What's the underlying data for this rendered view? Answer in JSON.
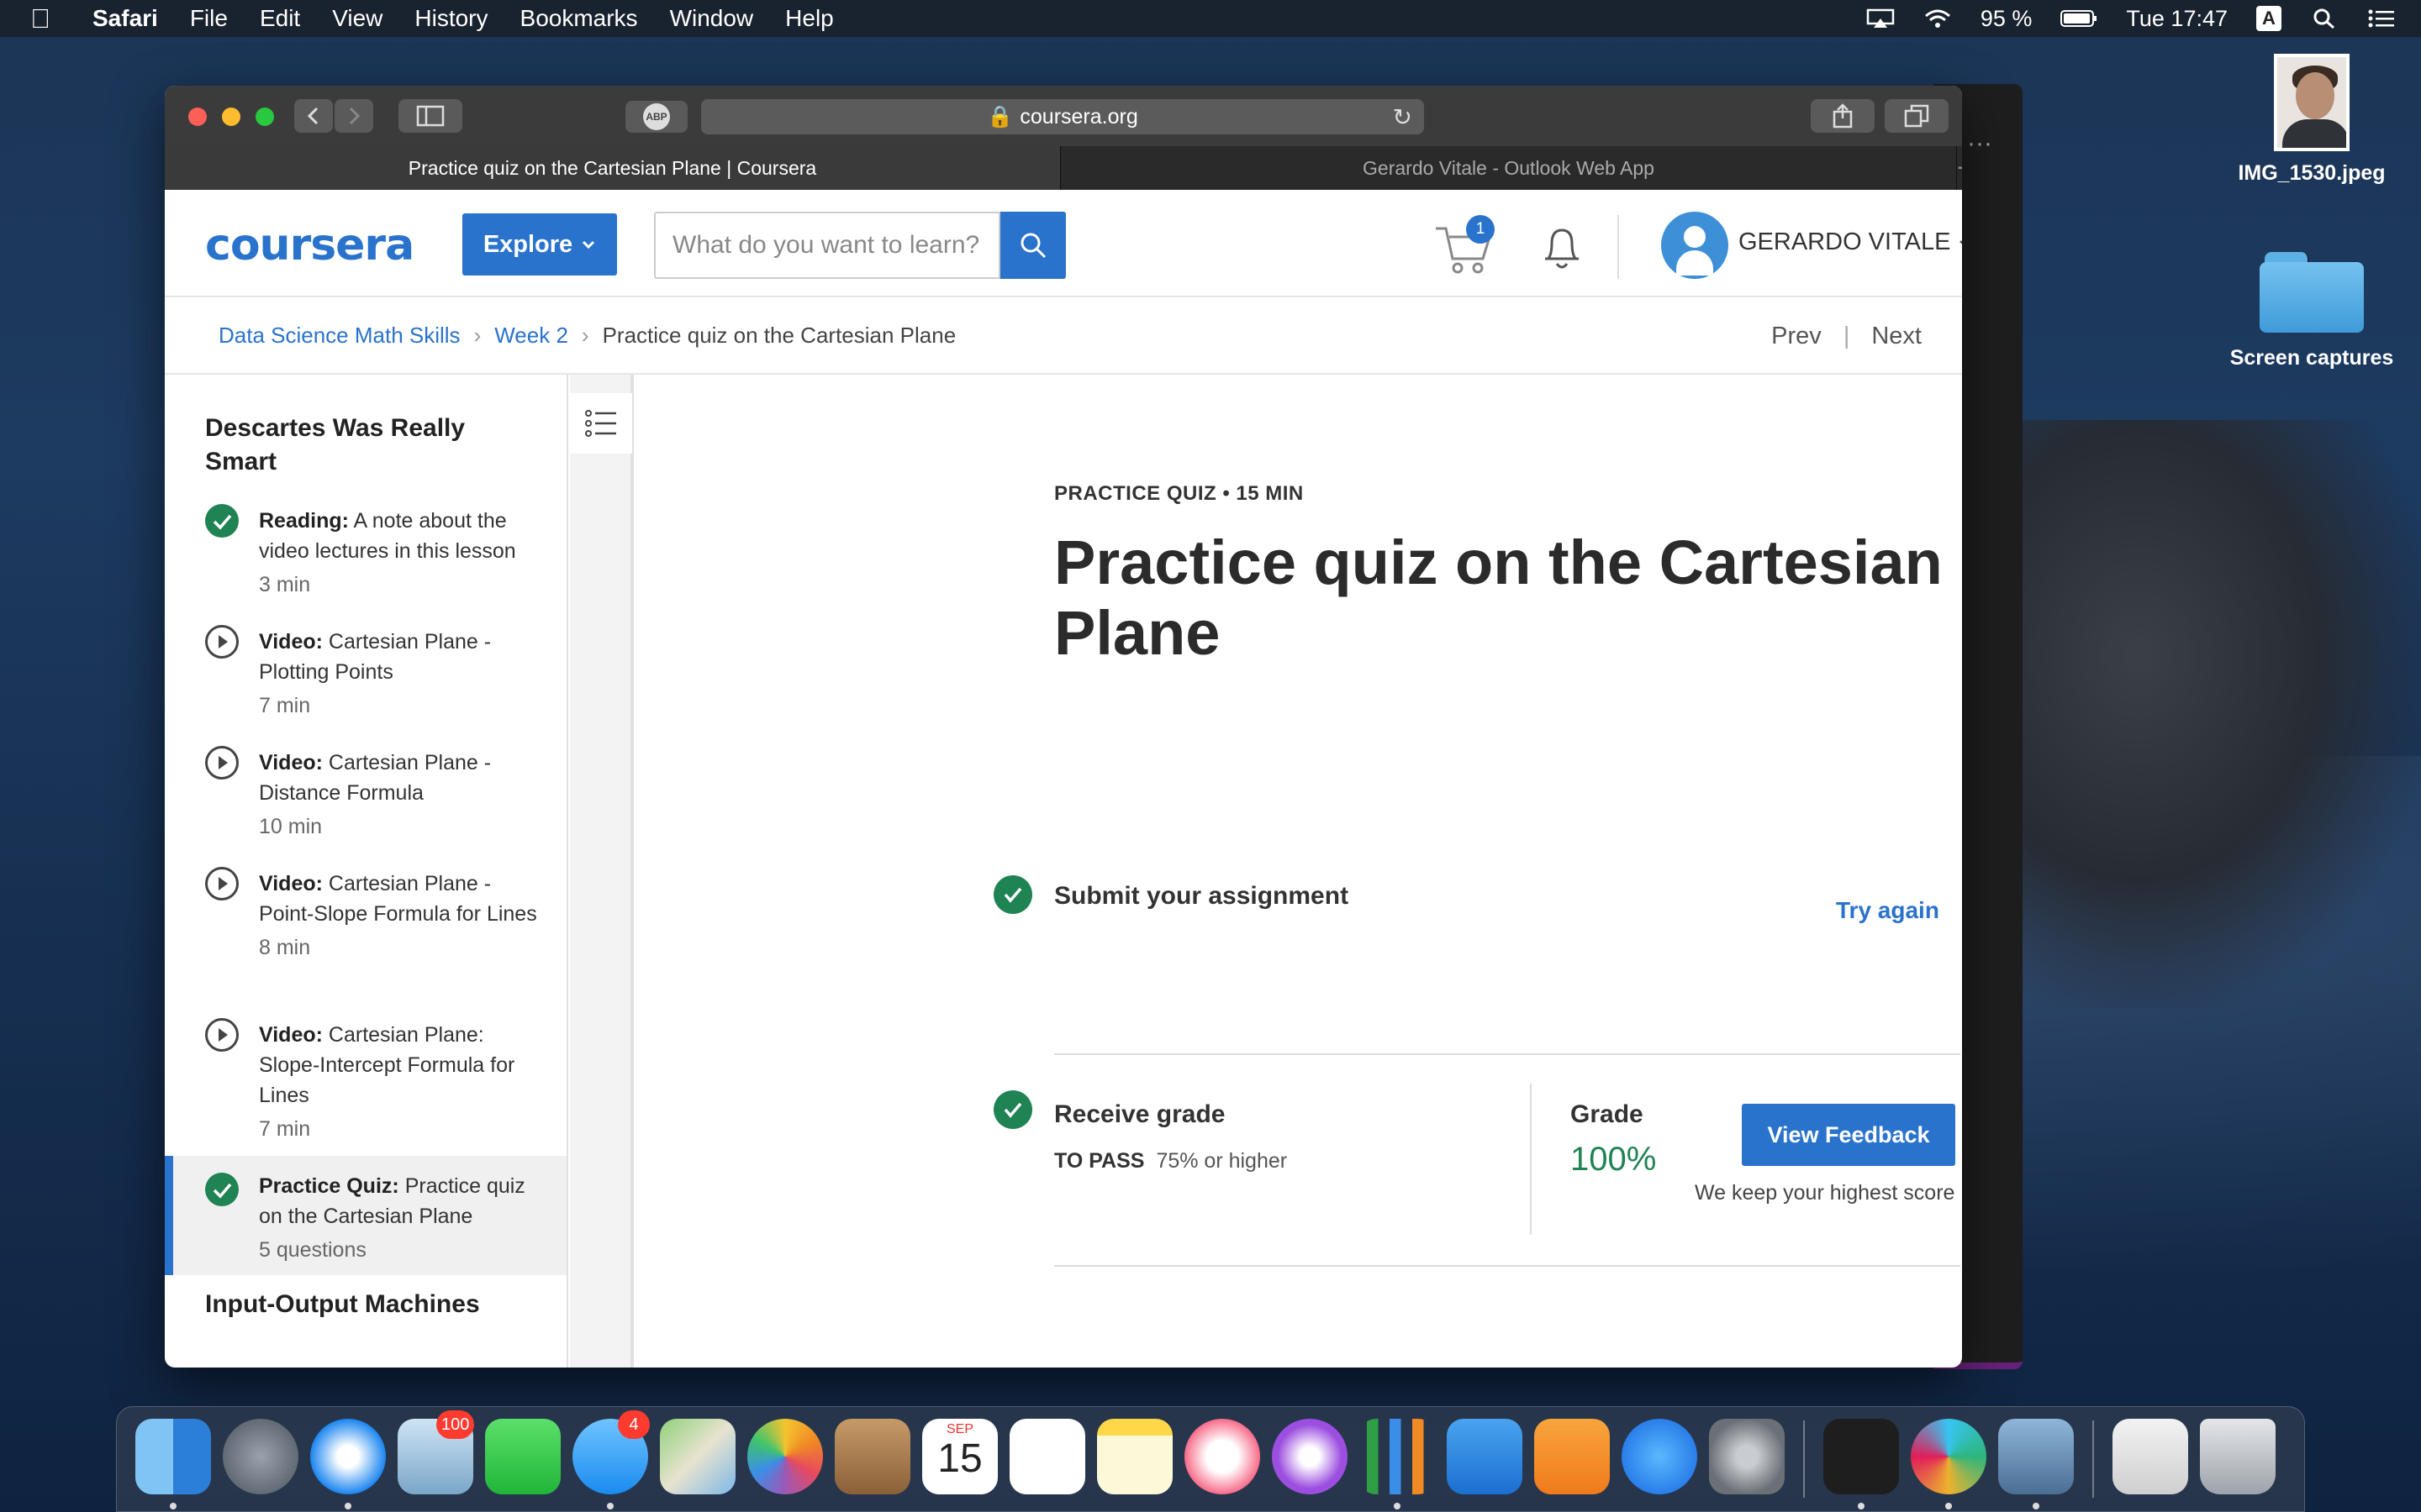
{
  "menubar": {
    "app": "Safari",
    "items": [
      "File",
      "Edit",
      "View",
      "History",
      "Bookmarks",
      "Window",
      "Help"
    ],
    "battery": "95 %",
    "clock": "Tue 17:47",
    "input_source": "A"
  },
  "desktop": {
    "photo_label": "IMG_1530.jpeg",
    "folder_label": "Screen captures"
  },
  "browser": {
    "url": "coursera.org",
    "abp": "ABP",
    "tabs": [
      {
        "title": "Practice quiz on the Cartesian Plane | Coursera"
      },
      {
        "title": "Gerardo Vitale - Outlook Web App"
      }
    ]
  },
  "header": {
    "logo": "coursera",
    "explore_label": "Explore",
    "search_placeholder": "What do you want to learn?",
    "cart_count": "1",
    "user_name": "GERARDO VITALE"
  },
  "breadcrumb": {
    "items": [
      "Data Science Math Skills",
      "Week 2"
    ],
    "current": "Practice quiz on the Cartesian Plane",
    "prev": "Prev",
    "next": "Next"
  },
  "sidebar": {
    "lesson_title": "Descartes Was Really Smart",
    "items": [
      {
        "type": "Reading:",
        "title": "A note about the video lectures in this lesson",
        "meta": "3 min",
        "status": "done"
      },
      {
        "type": "Video:",
        "title": "Cartesian Plane - Plotting Points",
        "meta": "7 min",
        "status": "play"
      },
      {
        "type": "Video:",
        "title": "Cartesian Plane - Distance Formula",
        "meta": "10 min",
        "status": "play"
      },
      {
        "type": "Video:",
        "title": "Cartesian Plane - Point-Slope Formula for Lines",
        "meta": "8 min",
        "status": "play"
      },
      {
        "type": "Video:",
        "title": "Cartesian Plane: Slope-Intercept Formula for Lines",
        "meta": "7 min",
        "status": "play"
      },
      {
        "type": "Practice Quiz:",
        "title": "Practice quiz on the Cartesian Plane",
        "meta": "5 questions",
        "status": "done"
      }
    ],
    "next_lesson": "Input-Output Machines"
  },
  "quiz": {
    "kicker": "PRACTICE QUIZ • 15 MIN",
    "title": "Practice quiz on the Cartesian Plane",
    "submit_label": "Submit your assignment",
    "try_again": "Try again",
    "receive_label": "Receive grade",
    "to_pass_label": "TO PASS",
    "to_pass_value": "75% or higher",
    "grade_label": "Grade",
    "grade_value": "100%",
    "view_feedback": "View Feedback",
    "keep_note": "We keep your highest score"
  },
  "dock": {
    "mail_badge": "100",
    "messages_badge": "4",
    "calendar_month": "SEP",
    "calendar_day": "15"
  },
  "colors": {
    "brand": "#2a73cc",
    "success": "#1f8354"
  }
}
